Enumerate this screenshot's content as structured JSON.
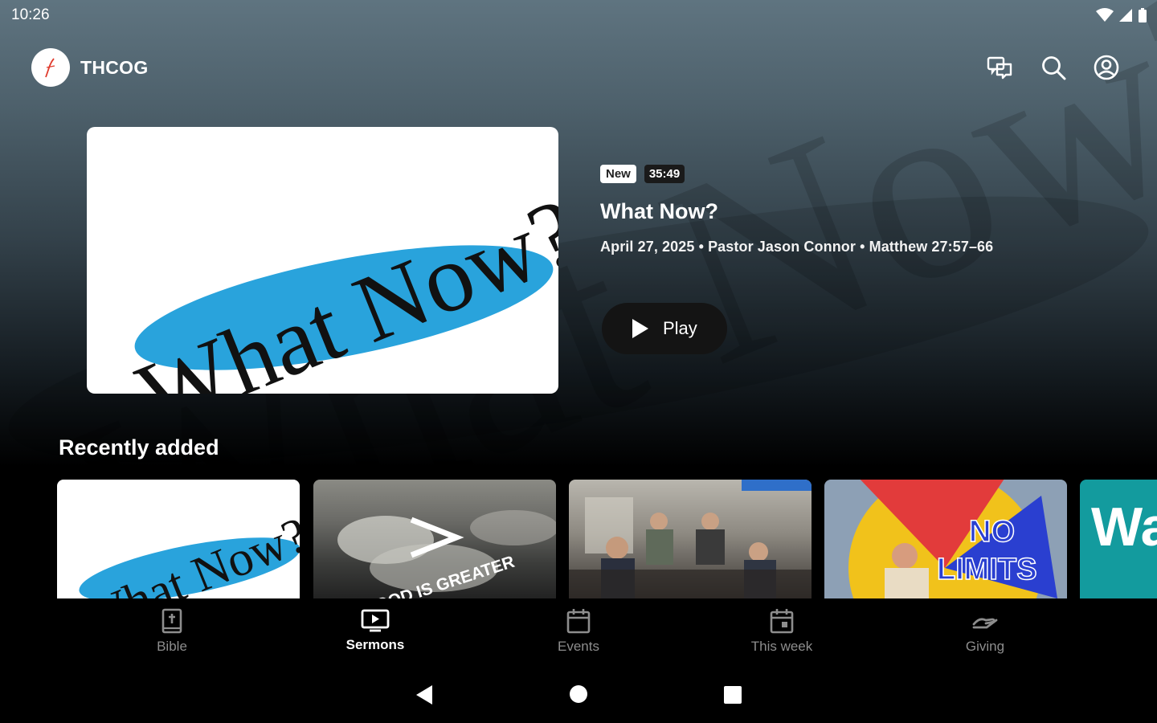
{
  "status": {
    "time": "10:26"
  },
  "app": {
    "name": "THCOG"
  },
  "hero": {
    "badge_new": "New",
    "duration": "35:49",
    "title": "What Now?",
    "meta": "April 27, 2025 • Pastor Jason Connor  • Matthew 27:57–66",
    "play_label": "Play",
    "artwork_text": "What Now?"
  },
  "recent": {
    "title": "Recently added",
    "cards": [
      {
        "art_text": "What Now?"
      },
      {
        "art_text": "GOD IS GREATER"
      },
      {
        "art_text": ""
      },
      {
        "art_line1": "NO",
        "art_line2": "LIMITS"
      },
      {
        "art_text": "Wa"
      }
    ]
  },
  "nav": {
    "items": [
      {
        "label": "Bible",
        "icon": "bible-icon"
      },
      {
        "label": "Sermons",
        "icon": "tv-icon",
        "active": true
      },
      {
        "label": "Events",
        "icon": "calendar-icon"
      },
      {
        "label": "This week",
        "icon": "calendar-week-icon"
      },
      {
        "label": "Giving",
        "icon": "giving-icon"
      }
    ]
  },
  "colors": {
    "accent_blue": "#29a3dc",
    "teal": "#139b9e",
    "brand_red": "#e03b2d"
  }
}
